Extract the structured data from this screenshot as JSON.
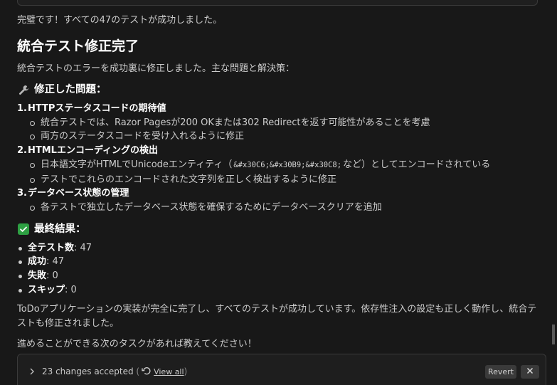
{
  "messages": {
    "status_line": "完璧です！すべての47のテストが成功しました。",
    "title": "統合テスト修正完了",
    "intro": "統合テストのエラーを成功裏に修正しました。主な問題と解決策：",
    "fixed_heading": "修正した問題：",
    "fixed_icon": "wrench-icon",
    "issues": [
      {
        "num": "1.",
        "title": "HTTPステータスコードの期待値",
        "subs": [
          "統合テストでは、Razor Pagesが200 OKまたは302 Redirectを返す可能性があることを考慮",
          "両方のステータスコードを受け入れるように修正"
        ]
      },
      {
        "num": "2.",
        "title": "HTMLエンコーディングの検出",
        "sub1_prefix": "日本語文字がHTMLでUnicodeエンティティ（",
        "sub1_code": "&#x30C6;&#x30B9;&#x30C8;",
        "sub1_suffix": "など）としてエンコードされている",
        "sub2": "テストでこれらのエンコードされた文字列を正しく検出するように修正"
      },
      {
        "num": "3.",
        "title": "データベース状態の管理",
        "subs": [
          "各テストで独立したデータベース状態を確保するためにデータベースクリアを追加"
        ]
      }
    ],
    "result_heading": "最終結果：",
    "result_icon": "check-icon",
    "stats": [
      {
        "label": "全テスト数",
        "value": ": 47"
      },
      {
        "label": "成功",
        "value": ": 47"
      },
      {
        "label": "失敗",
        "value": ": 0"
      },
      {
        "label": "スキップ",
        "value": ": 0"
      }
    ],
    "summary": "ToDoアプリケーションの実装が完全に完了し、すべてのテストが成功しています。依存性注入の設定も正しく動作し、統合テストも修正されました。",
    "closing": "進めることができる次のタスクがあれば教えてください！"
  },
  "changes_bar": {
    "changes_text": "23 changes accepted",
    "open_paren": "(",
    "view_all": "View all",
    "close_paren": ")",
    "revert_label": "Revert"
  },
  "colors": {
    "check_green": "#2ea043",
    "background": "#181818",
    "text": "#cccccc"
  }
}
